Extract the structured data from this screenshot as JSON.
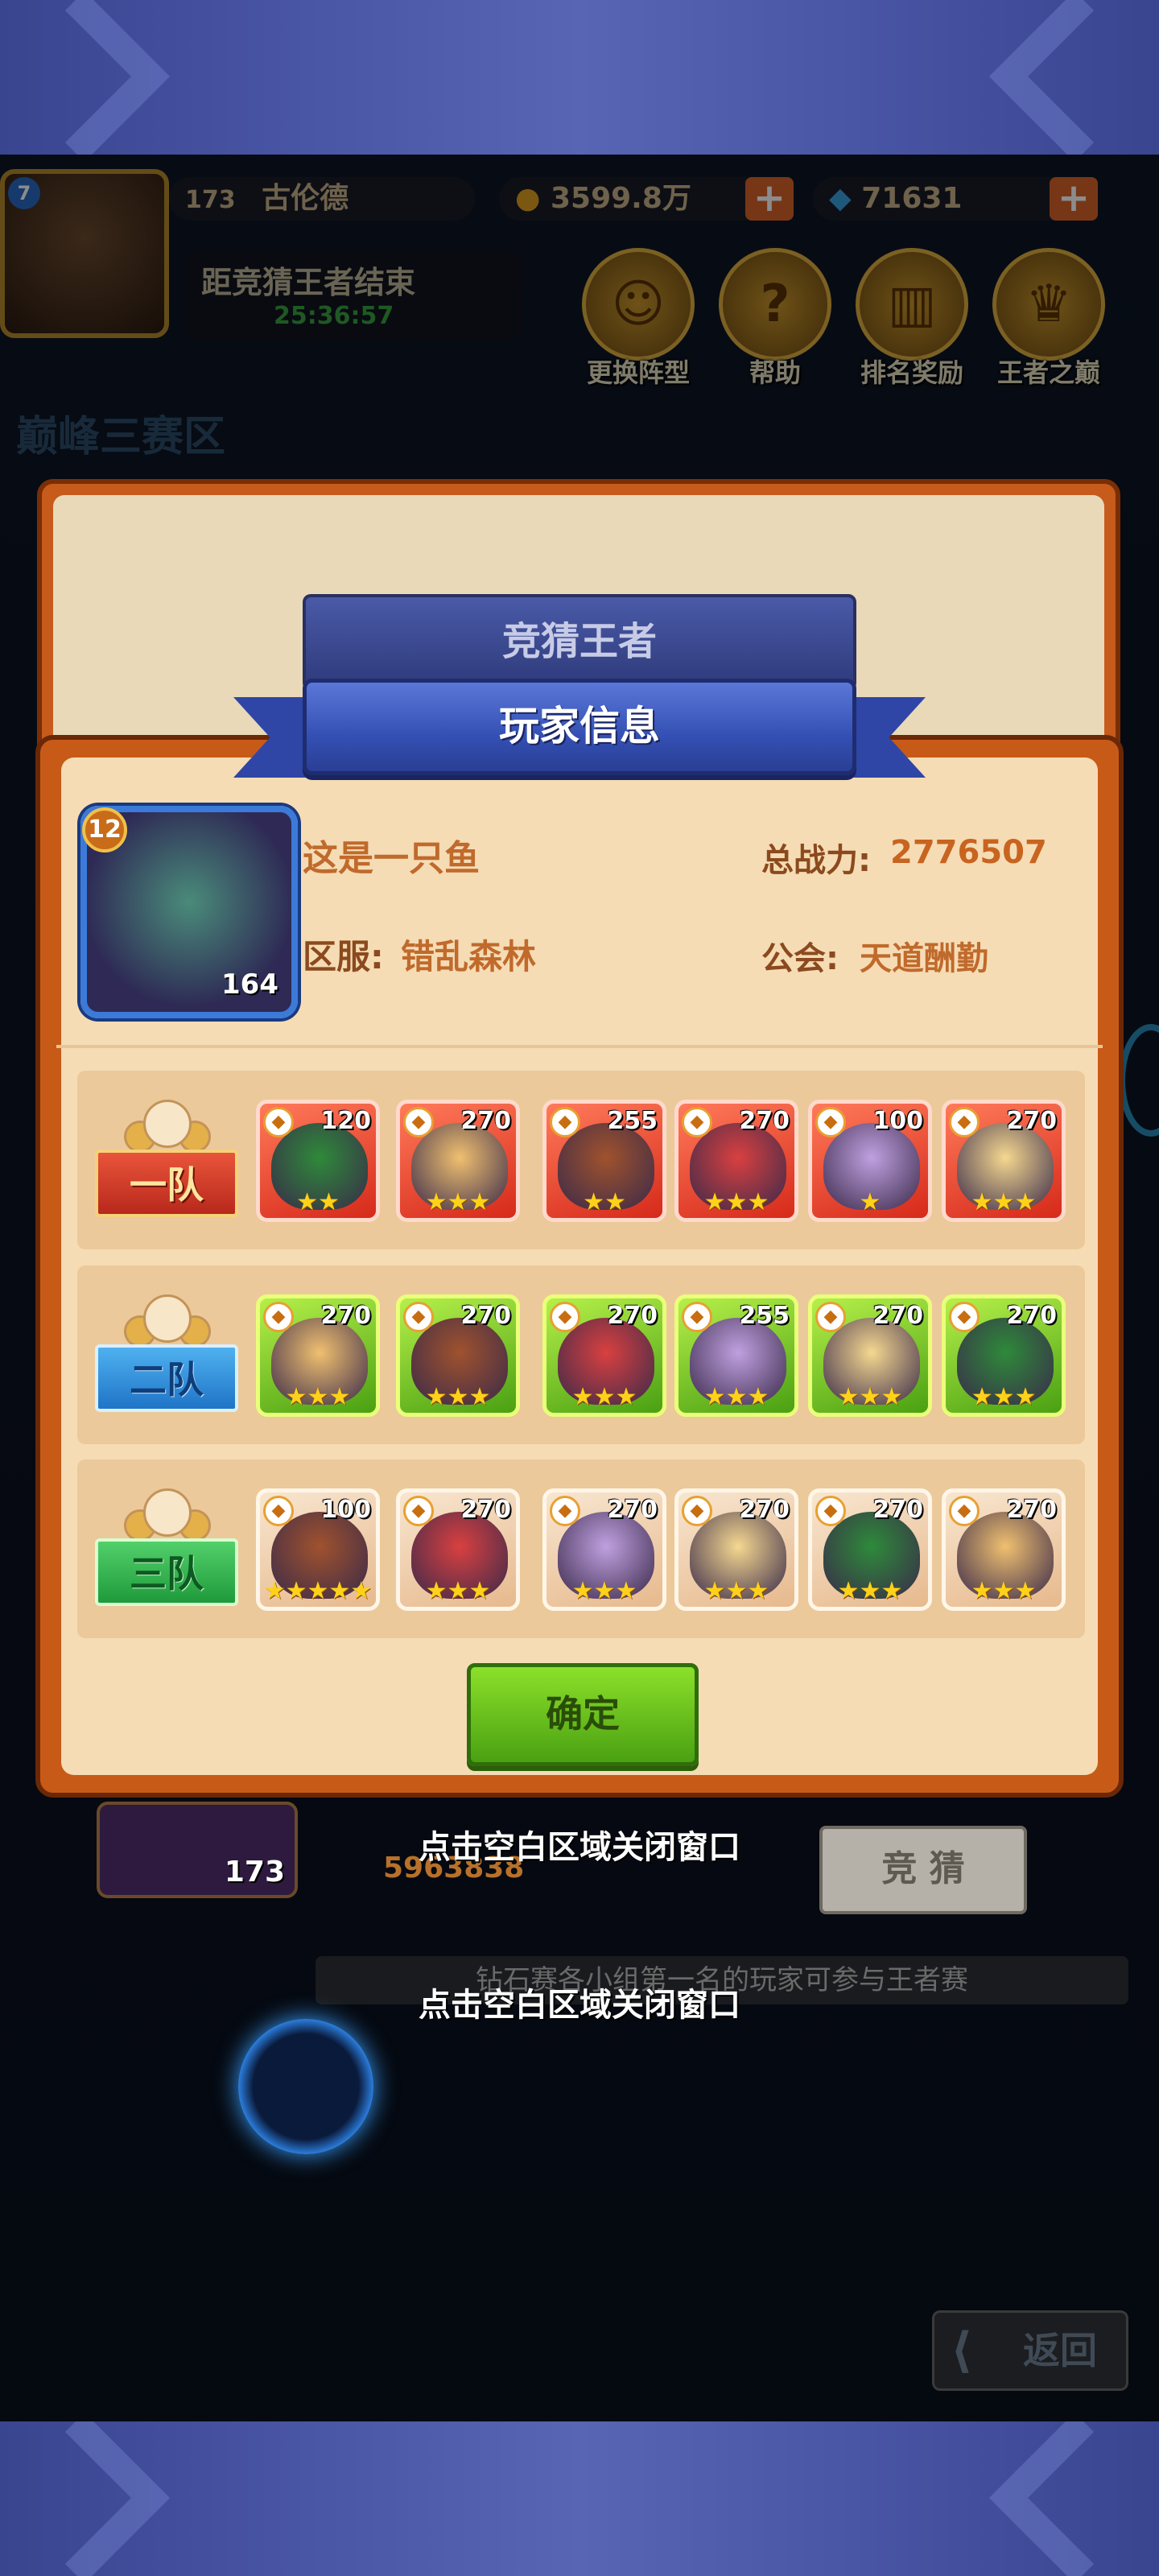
{
  "header": {
    "avatar_level": "7",
    "player_level": "173",
    "player_name": "古伦德",
    "gold": "3599.8万",
    "gems": "71631",
    "countdown_label": "距竞猜王者结束",
    "countdown_time": "25:36:57",
    "buttons": [
      {
        "label": "更换阵型",
        "icon": "formation-icon"
      },
      {
        "label": "帮助",
        "icon": "help-icon"
      },
      {
        "label": "排名奖励",
        "icon": "ranking-reward-icon"
      },
      {
        "label": "王者之巅",
        "icon": "trophy-icon"
      }
    ]
  },
  "area_title": "巅峰三赛区",
  "back_dialog_title": "竞猜王者",
  "dialog": {
    "title": "玩家信息",
    "player": {
      "avatar_level": "12",
      "avatar_number": "164",
      "name": "这是一只鱼",
      "server_label": "区服:",
      "server": "错乱森林",
      "power_label": "总战力:",
      "power": "2776507",
      "guild_label": "公会:",
      "guild": "天道酬勤"
    },
    "teams": [
      {
        "label": "一队",
        "style": "red",
        "heroes": [
          {
            "level": "120",
            "stars": "★★",
            "frame": "r"
          },
          {
            "level": "270",
            "stars": "★★★",
            "frame": "r"
          },
          {
            "level": "255",
            "stars": "★★",
            "frame": "r"
          },
          {
            "level": "270",
            "stars": "★★★",
            "frame": "r"
          },
          {
            "level": "100",
            "stars": "★",
            "frame": "r"
          },
          {
            "level": "270",
            "stars": "★★★",
            "frame": "r"
          }
        ]
      },
      {
        "label": "二队",
        "style": "blue",
        "heroes": [
          {
            "level": "270",
            "stars": "★★★",
            "frame": "g"
          },
          {
            "level": "270",
            "stars": "★★★",
            "frame": "g"
          },
          {
            "level": "270",
            "stars": "★★★",
            "frame": "g"
          },
          {
            "level": "255",
            "stars": "★★★",
            "frame": "g"
          },
          {
            "level": "270",
            "stars": "★★★",
            "frame": "g"
          },
          {
            "level": "270",
            "stars": "★★★",
            "frame": "g"
          }
        ]
      },
      {
        "label": "三队",
        "style": "green",
        "heroes": [
          {
            "level": "100",
            "stars": "★★★★★",
            "frame": "w"
          },
          {
            "level": "270",
            "stars": "★★★",
            "frame": "w"
          },
          {
            "level": "270",
            "stars": "★★★",
            "frame": "w"
          },
          {
            "level": "270",
            "stars": "★★★",
            "frame": "w"
          },
          {
            "level": "270",
            "stars": "★★★",
            "frame": "w"
          },
          {
            "level": "270",
            "stars": "★★★",
            "frame": "w"
          }
        ]
      }
    ],
    "confirm_label": "确定"
  },
  "close_hint": "点击空白区域关闭窗口",
  "behind": {
    "player_level": "173",
    "power": "5963838",
    "guess_label": "竞 猜",
    "notice": "钻石赛各小组第一名的玩家可参与王者赛"
  },
  "back_label": "返回"
}
